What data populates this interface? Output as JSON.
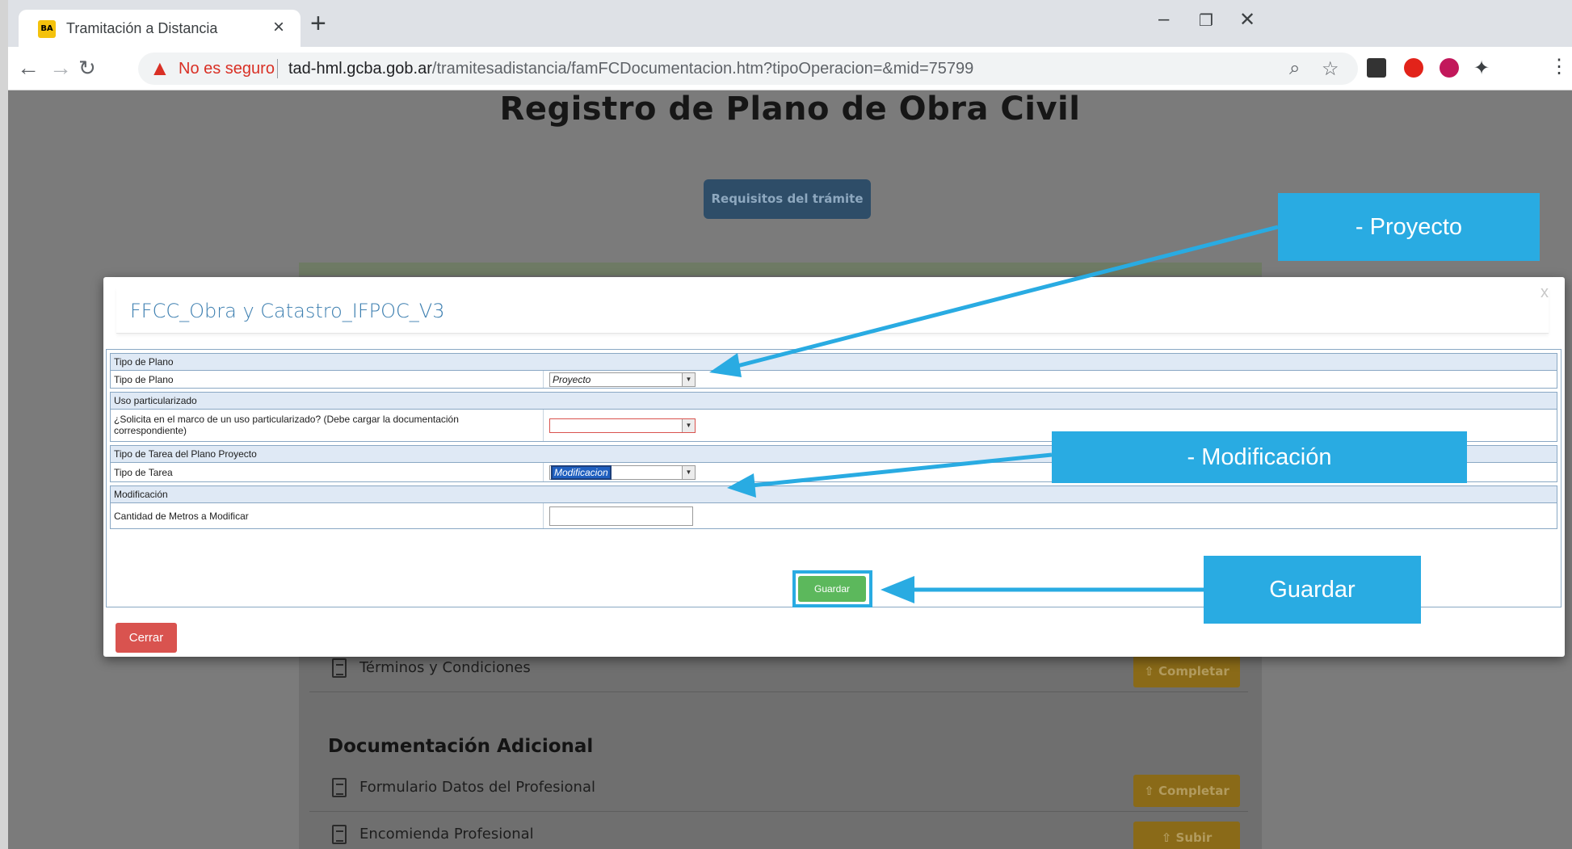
{
  "browser": {
    "tab_title": "Tramitación a Distancia",
    "favicon_text": "BA",
    "new_tab_glyph": "+",
    "security_text": "No es seguro",
    "url_host": "tad-hml.gcba.gob.ar",
    "url_path": "/tramitesadistancia/famFCDocumentacion.htm?tipoOperacion=&mid=75799"
  },
  "page": {
    "title": "Registro de Plano de Obra Civil",
    "requirements_button": "Requisitos del trámite",
    "doc_rows": [
      {
        "label": "Términos y Condiciones",
        "button": "Completar"
      }
    ],
    "additional_heading": "Documentación Adicional",
    "additional_rows": [
      {
        "label": "Formulario Datos del Profesional",
        "button": "Completar"
      },
      {
        "label": "Encomienda Profesional",
        "button": "Subir"
      }
    ]
  },
  "modal": {
    "title": "FFCC_Obra y Catastro_IFPOC_V3",
    "close_glyph": "x",
    "sections": [
      {
        "header": "Tipo de Plano",
        "field_label": "Tipo de Plano",
        "value": "Proyecto"
      },
      {
        "header": "Uso particularizado",
        "field_label": "¿Solicita en el marco de un uso particularizado? (Debe cargar la documentación correspondiente)",
        "value": ""
      },
      {
        "header": "Tipo de Tarea del Plano Proyecto",
        "field_label": "Tipo de Tarea",
        "value": "Modificacion"
      },
      {
        "header": "Modificación",
        "field_label": "Cantidad de Metros a Modificar",
        "value": ""
      }
    ],
    "save_button": "Guardar",
    "close_button": "Cerrar"
  },
  "callouts": {
    "proyecto": "-   Proyecto",
    "modificacion": "-   Modificación",
    "guardar": "Guardar"
  },
  "colors": {
    "callout": "#29abe2",
    "save": "#5cb85c",
    "close": "#d9534f",
    "title_blue": "#3d7fb0"
  }
}
